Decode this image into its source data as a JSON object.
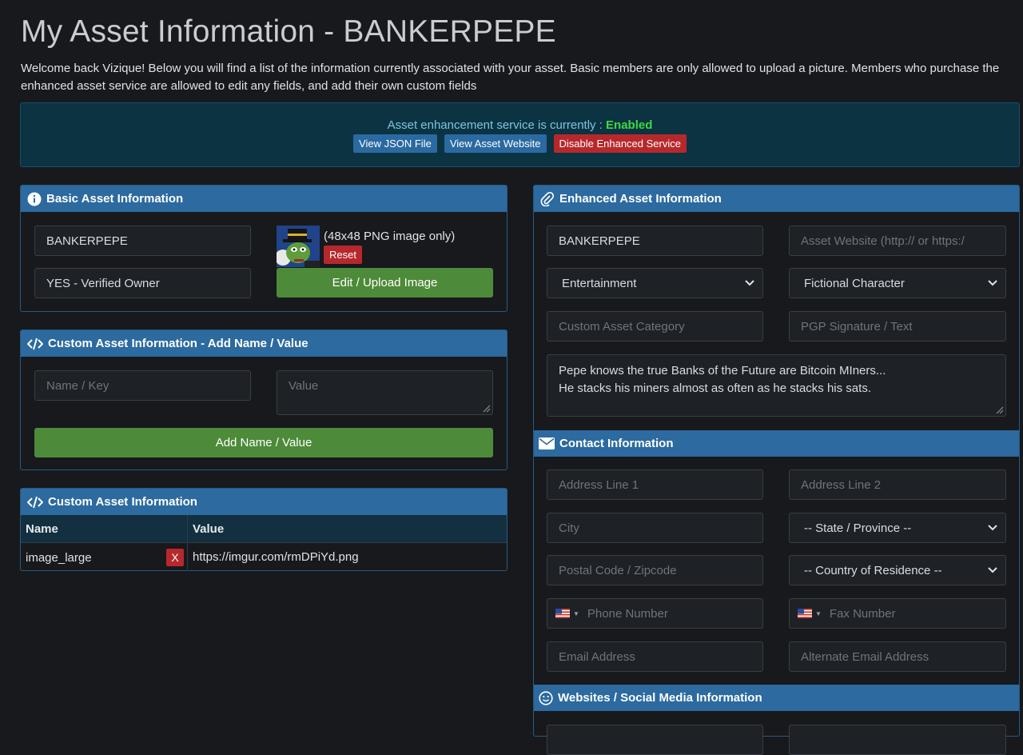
{
  "page": {
    "title": "My Asset Information - BANKERPEPE",
    "intro": "Welcome back Vizique! Below you will find a list of the information currently associated with your asset. Basic members are only allowed to upload a picture. Members who purchase the enhanced asset service are allowed to edit any fields, and add their own custom fields"
  },
  "banner": {
    "status_text": "Asset enhancement service is currently : ",
    "status_value": "Enabled",
    "buttons": {
      "view_json": "View JSON File",
      "view_website": "View Asset Website",
      "disable": "Disable Enhanced Service"
    }
  },
  "basic": {
    "header": "Basic Asset Information",
    "asset_name": "BANKERPEPE",
    "owner_status": "YES - Verified Owner",
    "image_note": "(48x48 PNG image only)",
    "reset_label": "Reset",
    "upload_label": "Edit / Upload Image"
  },
  "custom_add": {
    "header": "Custom Asset Information - Add Name / Value",
    "name_placeholder": "Name / Key",
    "value_placeholder": "Value",
    "add_label": "Add Name / Value"
  },
  "custom_list": {
    "header": "Custom Asset Information",
    "columns": [
      "Name",
      "Value"
    ],
    "rows": [
      {
        "name": "image_large",
        "value": "https://imgur.com/rmDPiYd.png",
        "delete_label": "X"
      }
    ]
  },
  "enhanced": {
    "header": "Enhanced Asset Information",
    "asset_name": "BANKERPEPE",
    "website_placeholder": "Asset Website (http:// or https:/",
    "category_1": "Entertainment",
    "category_2": "Fictional Character",
    "custom_category_placeholder": "Custom Asset Category",
    "pgp_placeholder": "PGP Signature / Text",
    "description_line_1": "Pepe knows the true Banks of the Future are Bitcoin MIners...",
    "description_line_2": "He stacks his miners almost as often as he stacks his sats."
  },
  "contact": {
    "header": "Contact Information",
    "address1_placeholder": "Address Line 1",
    "address2_placeholder": "Address Line 2",
    "city_placeholder": "City",
    "state_selected": "-- State / Province --",
    "postal_placeholder": "Postal Code / Zipcode",
    "country_selected": "-- Country of Residence --",
    "phone_placeholder": "Phone Number",
    "fax_placeholder": "Fax Number",
    "email_placeholder": "Email Address",
    "alt_email_placeholder": "Alternate Email Address"
  },
  "social": {
    "header": "Websites / Social Media Information"
  },
  "colors": {
    "header_blue": "#2c6a9f",
    "enabled_green": "#3ed940",
    "action_green": "#4d8a39",
    "danger_red": "#b7282c"
  }
}
